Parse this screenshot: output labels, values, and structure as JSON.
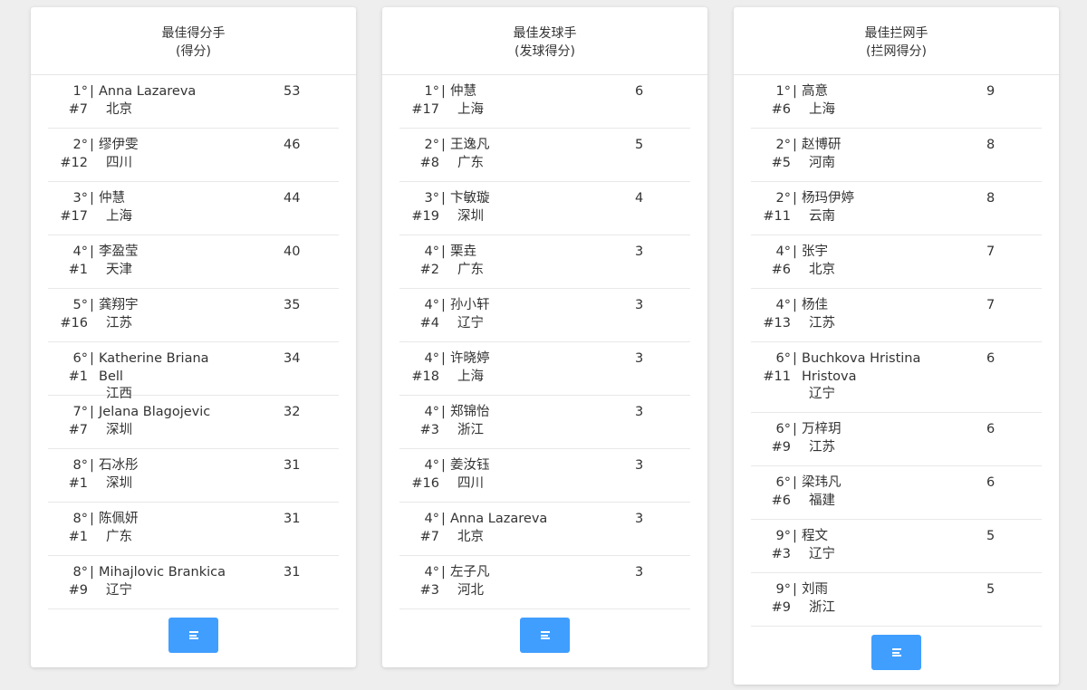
{
  "accent_color": "#409eff",
  "menu_icon": "hamburger-menu-icon",
  "cards": [
    {
      "title": "最佳得分手",
      "subtitle": "(得分)",
      "rows": [
        {
          "rank": "1°",
          "number": "#7",
          "name": "Anna Lazareva",
          "team": "北京",
          "score": "53"
        },
        {
          "rank": "2°",
          "number": "#12",
          "name": "缪伊雯",
          "team": "四川",
          "score": "46"
        },
        {
          "rank": "3°",
          "number": "#17",
          "name": "仲慧",
          "team": "上海",
          "score": "44"
        },
        {
          "rank": "4°",
          "number": "#1",
          "name": "李盈莹",
          "team": "天津",
          "score": "40"
        },
        {
          "rank": "5°",
          "number": "#16",
          "name": "龚翔宇",
          "team": "江苏",
          "score": "35"
        },
        {
          "rank": "6°",
          "number": "#1",
          "name": "Katherine Briana Bell",
          "team": "江西",
          "score": "34"
        },
        {
          "rank": "7°",
          "number": "#7",
          "name": "Jelana Blagojevic",
          "team": "深圳",
          "score": "32"
        },
        {
          "rank": "8°",
          "number": "#1",
          "name": "石冰彤",
          "team": "深圳",
          "score": "31"
        },
        {
          "rank": "8°",
          "number": "#1",
          "name": "陈佩妍",
          "team": "广东",
          "score": "31"
        },
        {
          "rank": "8°",
          "number": "#9",
          "name": "Mihajlovic Brankica",
          "team": "辽宁",
          "score": "31"
        }
      ]
    },
    {
      "title": "最佳发球手",
      "subtitle": "(发球得分)",
      "rows": [
        {
          "rank": "1°",
          "number": "#17",
          "name": "仲慧",
          "team": "上海",
          "score": "6"
        },
        {
          "rank": "2°",
          "number": "#8",
          "name": "王逸凡",
          "team": "广东",
          "score": "5"
        },
        {
          "rank": "3°",
          "number": "#19",
          "name": "卞敏璇",
          "team": "深圳",
          "score": "4"
        },
        {
          "rank": "4°",
          "number": "#2",
          "name": "栗垚",
          "team": "广东",
          "score": "3"
        },
        {
          "rank": "4°",
          "number": "#4",
          "name": "孙小轩",
          "team": "辽宁",
          "score": "3"
        },
        {
          "rank": "4°",
          "number": "#18",
          "name": "许晓婷",
          "team": "上海",
          "score": "3"
        },
        {
          "rank": "4°",
          "number": "#3",
          "name": "郑锦怡",
          "team": "浙江",
          "score": "3"
        },
        {
          "rank": "4°",
          "number": "#16",
          "name": "姜汝钰",
          "team": "四川",
          "score": "3"
        },
        {
          "rank": "4°",
          "number": "#7",
          "name": "Anna Lazareva",
          "team": "北京",
          "score": "3"
        },
        {
          "rank": "4°",
          "number": "#3",
          "name": "左子凡",
          "team": "河北",
          "score": "3"
        }
      ]
    },
    {
      "title": "最佳拦网手",
      "subtitle": "(拦网得分)",
      "rows": [
        {
          "rank": "1°",
          "number": "#6",
          "name": "高意",
          "team": "上海",
          "score": "9"
        },
        {
          "rank": "2°",
          "number": "#5",
          "name": "赵博研",
          "team": "河南",
          "score": "8"
        },
        {
          "rank": "2°",
          "number": "#11",
          "name": "杨玛伊婷",
          "team": "云南",
          "score": "8"
        },
        {
          "rank": "4°",
          "number": "#6",
          "name": "张宇",
          "team": "北京",
          "score": "7"
        },
        {
          "rank": "4°",
          "number": "#13",
          "name": "杨佳",
          "team": "江苏",
          "score": "7"
        },
        {
          "rank": "6°",
          "number": "#11",
          "name": "Buchkova Hristina Hristova",
          "team": "辽宁",
          "score": "6"
        },
        {
          "rank": "6°",
          "number": "#9",
          "name": "万梓玥",
          "team": "江苏",
          "score": "6"
        },
        {
          "rank": "6°",
          "number": "#6",
          "name": "梁玮凡",
          "team": "福建",
          "score": "6"
        },
        {
          "rank": "9°",
          "number": "#3",
          "name": "程文",
          "team": "辽宁",
          "score": "5"
        },
        {
          "rank": "9°",
          "number": "#9",
          "name": "刘雨",
          "team": "浙江",
          "score": "5"
        }
      ]
    }
  ]
}
